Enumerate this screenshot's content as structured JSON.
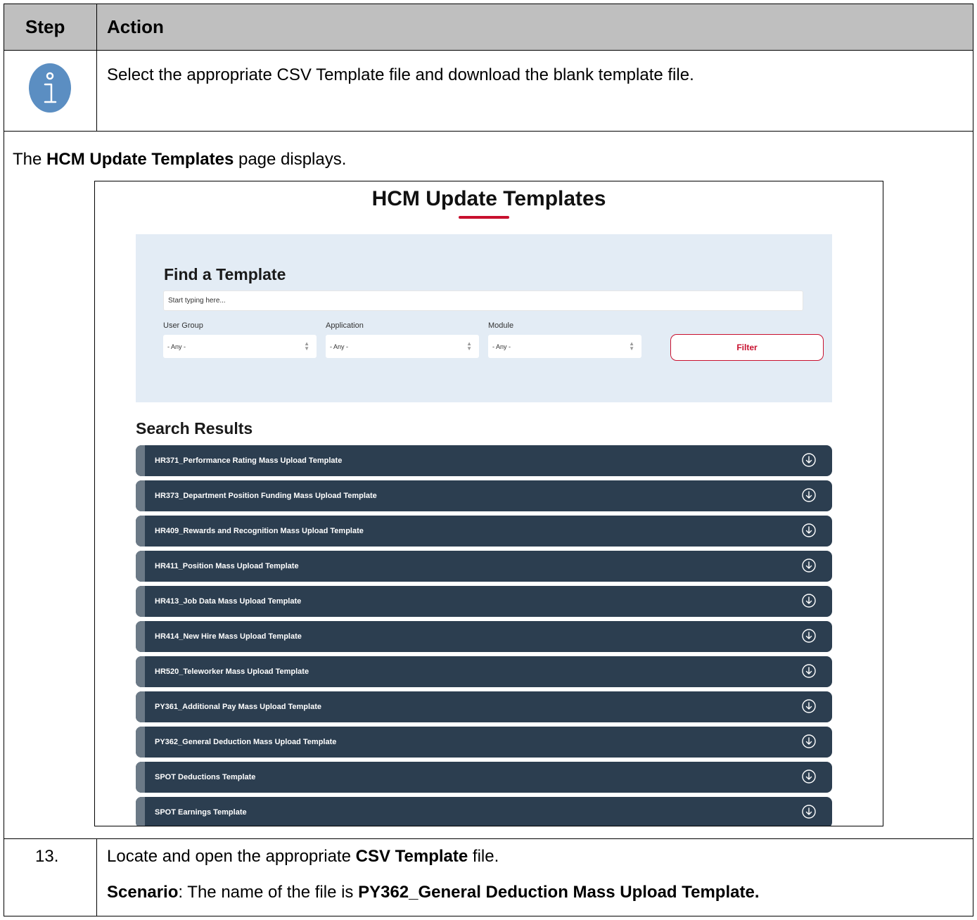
{
  "table": {
    "header": {
      "step": "Step",
      "action": "Action"
    },
    "note": "Select the appropriate CSV Template file and download the blank template file.",
    "page_displays": {
      "prefix": "The ",
      "bold": "HCM Update Templates",
      "suffix": " page displays."
    },
    "step_13": {
      "number": "13.",
      "line1_prefix": "Locate and open the appropriate ",
      "line1_bold": "CSV Template",
      "line1_suffix": " file.",
      "line2_bold1": "Scenario",
      "line2_middle": ": The name of the file is ",
      "line2_bold2": "PY362_General Deduction Mass Upload Template."
    }
  },
  "screenshot": {
    "title": "HCM Update Templates",
    "find": {
      "title": "Find a Template",
      "search_placeholder": "Start typing here...",
      "filters": [
        {
          "label": "User Group",
          "value": "- Any -"
        },
        {
          "label": "Application",
          "value": "- Any -"
        },
        {
          "label": "Module",
          "value": "- Any -"
        }
      ],
      "filter_button": "Filter"
    },
    "results": {
      "title": "Search Results",
      "items": [
        "HR371_Performance Rating Mass Upload Template",
        "HR373_Department Position Funding Mass Upload Template",
        "HR409_Rewards and Recognition Mass Upload Template",
        "HR411_Position Mass Upload Template",
        "HR413_Job Data Mass Upload Template",
        "HR414_New Hire Mass Upload Template",
        "HR520_Teleworker Mass Upload Template",
        "PY361_Additional Pay Mass Upload Template",
        "PY362_General Deduction Mass Upload Template",
        "SPOT Deductions Template",
        "SPOT Earnings Template"
      ],
      "row_icon": "download-circle-icon"
    },
    "colors": {
      "accent": "#c8102e",
      "row_bg": "#2c3e50",
      "panel_bg": "#e3ecf5",
      "info_icon": "#5b8ec2"
    }
  }
}
